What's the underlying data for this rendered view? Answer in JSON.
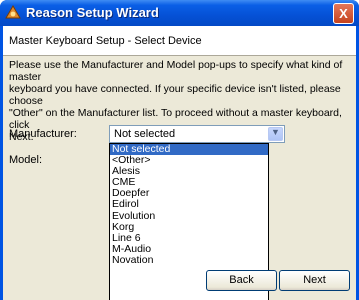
{
  "window": {
    "title": "Reason Setup Wizard",
    "close_label": "X"
  },
  "header": {
    "title": "Master Keyboard Setup - Select Device"
  },
  "instructions": "Please use the Manufacturer and Model pop-ups to specify what kind of master\nkeyboard you have connected. If your specific device isn't listed, please choose\n\"Other\" on the Manufacturer list. To proceed without a master keyboard, click\nNext.",
  "form": {
    "manufacturer_label": "Manufacturer:",
    "manufacturer_value": "Not selected",
    "model_label": "Model:"
  },
  "dropdown": {
    "options": [
      "Not selected",
      "<Other>",
      "Alesis",
      "CME",
      "Doepfer",
      "Edirol",
      "Evolution",
      "Korg",
      "Line 6",
      "M-Audio",
      "Novation"
    ],
    "selected_index": 0
  },
  "buttons": {
    "back": "Back",
    "next": "Next"
  },
  "colors": {
    "title_bar": "#0a5fe6",
    "highlight": "#316ac5",
    "face": "#ece9d8"
  }
}
